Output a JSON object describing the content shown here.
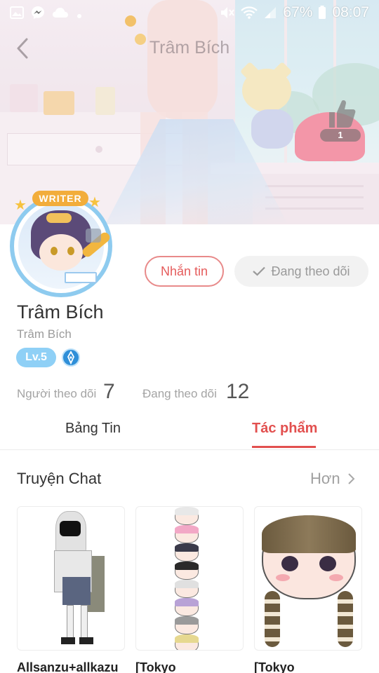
{
  "status_bar": {
    "battery": "67%",
    "time": "08:07",
    "left_icons": [
      "gallery-icon",
      "messenger-icon",
      "cloud-icon",
      "dot-icon"
    ],
    "right_icons": [
      "mute-icon",
      "wifi-icon",
      "signal-icon",
      "battery-icon"
    ]
  },
  "header": {
    "title": "Trâm Bích",
    "back_icon": "chevron-left-icon",
    "like_icon": "thumbs-up-icon",
    "like_count": "1"
  },
  "profile": {
    "avatar_badge": "WRITER",
    "name": "Trâm Bích",
    "handle": "Trâm Bích",
    "level": "Lv.5",
    "message_button": "Nhắn tin",
    "following_button": "Đang theo dõi",
    "followers_label": "Người theo dõi",
    "followers_count": "7",
    "following_label": "Đang theo dõi",
    "following_count": "12"
  },
  "tabs": [
    {
      "label": "Bảng Tin",
      "active": false
    },
    {
      "label": "Tác phẩm",
      "active": true
    }
  ],
  "section": {
    "title": "Truyện Chat",
    "more": "Hơn"
  },
  "cards": [
    {
      "title": "Allsanzu+allkazu"
    },
    {
      "title": "[Tokyo"
    },
    {
      "title": "[Tokyo"
    }
  ],
  "colors": {
    "accent": "#e2504f",
    "message_border": "#e88a8a",
    "level_badge": "#8fd0f6",
    "avatar_ring": "#8ecbef"
  }
}
